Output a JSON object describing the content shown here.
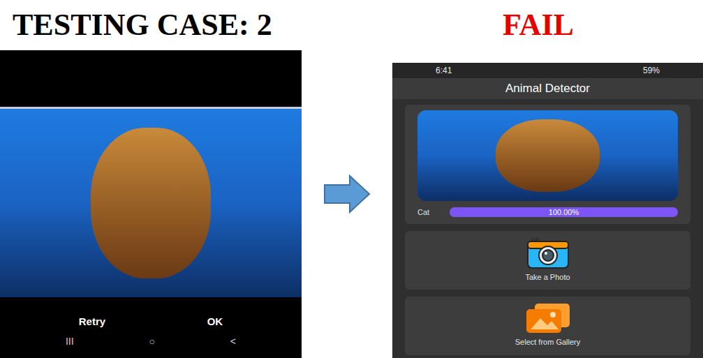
{
  "slide": {
    "title": "TESTING CASE: 2",
    "result": "FAIL"
  },
  "camera_preview": {
    "buttons": [
      "Retry",
      "OK"
    ],
    "nav_buttons": [
      "III",
      "○",
      "<"
    ]
  },
  "app": {
    "status_bar": {
      "time": "6:41",
      "battery": "59%"
    },
    "title": "Animal Detector",
    "prediction": {
      "label": "Cat",
      "level": 1.0,
      "reading": "100.00%"
    },
    "actions": [
      {
        "label": "Take a Photo",
        "kind": "camera"
      },
      {
        "label": "Select from Gallery",
        "kind": "gallery"
      }
    ]
  }
}
